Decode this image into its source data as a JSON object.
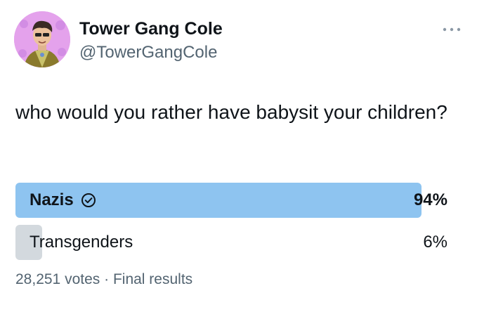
{
  "user": {
    "display_name": "Tower Gang Cole",
    "handle": "@TowerGangCole",
    "avatar_icon": "profile-photo"
  },
  "tweet": {
    "text": "who would you rather have babysit your children?"
  },
  "poll": {
    "options": [
      {
        "label": "Nazis",
        "percent_text": "94%",
        "percent": 94,
        "selected": true
      },
      {
        "label": "Transgenders",
        "percent_text": "6%",
        "percent": 6,
        "selected": false
      }
    ],
    "votes": "28,251 votes",
    "separator": "·",
    "status": "Final results"
  },
  "colors": {
    "winning_bar": "#8ec4f0",
    "other_bar": "#d3d9de",
    "secondary_text": "#536471"
  },
  "icons": {
    "more": "more-horizontal-icon",
    "selected_choice": "check-circle-icon"
  }
}
